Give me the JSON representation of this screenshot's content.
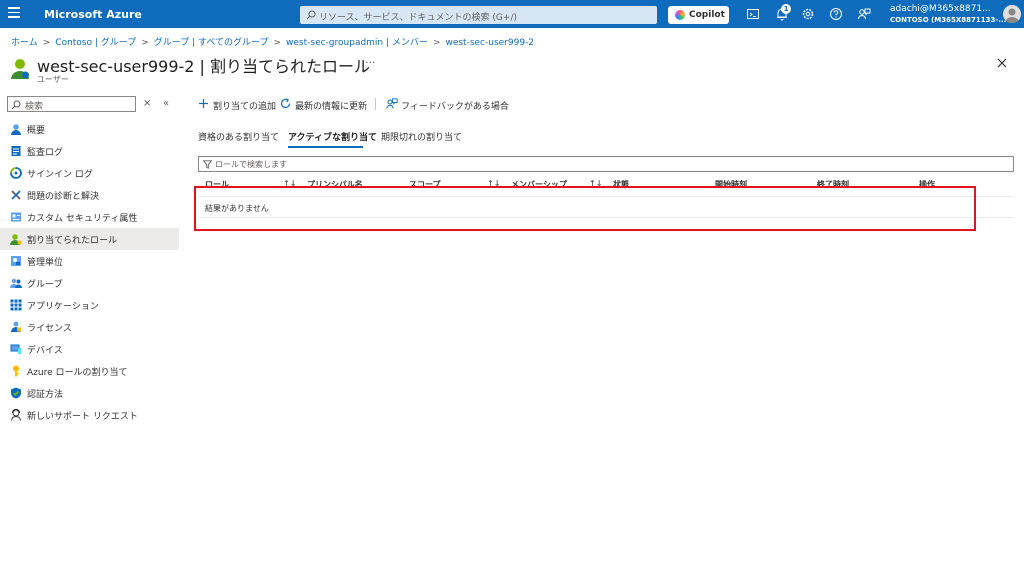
{
  "topbar": {
    "title": "Microsoft Azure",
    "search_placeholder": "リソース、サービス、ドキュメントの検索 (G+/)",
    "copilot_label": "Copilot",
    "notification_count": "1",
    "user_name": "adachi@M365x8871...",
    "user_tenant": "CONTOSO (M365X8871133-...",
    "icons": [
      "menu-icon",
      "search-icon",
      "cloud-shell-icon",
      "notifications-icon",
      "settings-icon",
      "help-icon",
      "feedback-icon",
      "avatar"
    ]
  },
  "breadcrumb": {
    "items": [
      "ホーム",
      "Contoso | グループ",
      "グループ | すべてのグループ",
      "west-sec-groupadmin | メンバー",
      "west-sec-user999-2"
    ]
  },
  "header": {
    "title": "west-sec-user999-2 | 割り当てられたロール",
    "more": "···",
    "subtitle": "ユーザー"
  },
  "sidebar": {
    "search_placeholder": "検索",
    "items": [
      {
        "label": "概要",
        "icon": "overview-icon"
      },
      {
        "label": "監査ログ",
        "icon": "audit-log-icon"
      },
      {
        "label": "サインイン ログ",
        "icon": "sign-in-log-icon"
      },
      {
        "label": "問題の診断と解決",
        "icon": "diagnose-icon"
      },
      {
        "label": "カスタム セキュリティ属性",
        "icon": "custom-security-icon"
      },
      {
        "label": "割り当てられたロール",
        "icon": "assigned-roles-icon",
        "active": true
      },
      {
        "label": "管理単位",
        "icon": "admin-units-icon"
      },
      {
        "label": "グループ",
        "icon": "groups-icon"
      },
      {
        "label": "アプリケーション",
        "icon": "applications-icon"
      },
      {
        "label": "ライセンス",
        "icon": "licenses-icon"
      },
      {
        "label": "デバイス",
        "icon": "devices-icon"
      },
      {
        "label": "Azure ロールの割り当て",
        "icon": "azure-role-icon"
      },
      {
        "label": "認証方法",
        "icon": "auth-methods-icon"
      },
      {
        "label": "新しいサポート リクエスト",
        "icon": "support-request-icon"
      }
    ]
  },
  "toolbar": {
    "add_label": "割り当ての追加",
    "refresh_label": "最新の情報に更新",
    "feedback_label": "フィードバックがある場合"
  },
  "tabs": [
    {
      "label": "資格のある割り当て"
    },
    {
      "label": "アクティブな割り当て",
      "active": true
    },
    {
      "label": "期限切れの割り当て"
    }
  ],
  "filter": {
    "placeholder": "ロールで検索します"
  },
  "table": {
    "columns": [
      "ロール",
      "プリンシパル名",
      "スコープ",
      "メンバーシップ",
      "状態",
      "開始時刻",
      "終了時刻",
      "操作"
    ],
    "empty_text": "結果がありません"
  },
  "colors": {
    "azure_blue": "#0f6cbd",
    "highlight_red": "#e0141e",
    "active_nav": "#edebe9"
  }
}
